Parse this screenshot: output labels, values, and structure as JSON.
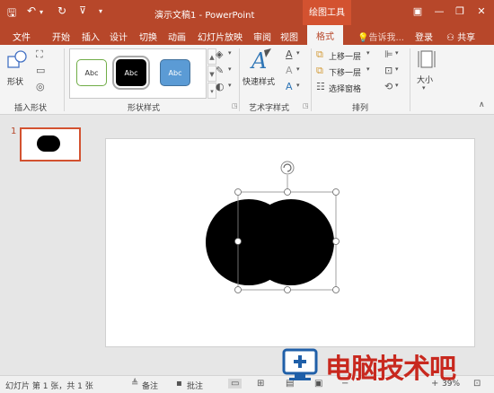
{
  "titlebar": {
    "title": "演示文稿1 - PowerPoint",
    "context_tab": "绘图工具",
    "icons": [
      "save-icon",
      "undo-icon",
      "redo-icon",
      "present-icon",
      "customize-icon"
    ],
    "window_buttons": [
      "▣",
      "—",
      "❐",
      "✕"
    ]
  },
  "tabs": {
    "items": [
      "文件",
      "开始",
      "插入",
      "设计",
      "切换",
      "动画",
      "幻灯片放映",
      "审阅",
      "视图"
    ],
    "active": "格式",
    "search": "告诉我...",
    "login": "登录",
    "share": "共享"
  },
  "ribbon": {
    "insert_shapes": {
      "label": "插入形状",
      "shapes_btn": "形状"
    },
    "shape_styles": {
      "label": "形状样式",
      "thumbs": [
        {
          "text": "Abc",
          "fill": "#ffffff",
          "border": "#70ad47",
          "color": "#333333"
        },
        {
          "text": "Abc",
          "fill": "#000000",
          "border": "#000000",
          "color": "#ffffff"
        },
        {
          "text": "Abc",
          "fill": "#5b9bd5",
          "border": "#41719c",
          "color": "#ffffff"
        }
      ]
    },
    "wordart": {
      "label": "艺术字样式",
      "quick_styles": "快速样式"
    },
    "arrange": {
      "label": "排列",
      "bring_forward": "上移一层",
      "send_backward": "下移一层",
      "selection_pane": "选择窗格"
    },
    "size": {
      "label": "大小"
    }
  },
  "thumbnail": {
    "slide_number": "1"
  },
  "statusbar": {
    "slide_info": "幻灯片 第 1 张，共 1 张",
    "notes": "备注",
    "comments": "批注",
    "zoom": "39%"
  },
  "watermark": {
    "text": "电脑技术吧"
  },
  "colors": {
    "accent": "#b7472a",
    "accent_light": "#d35230",
    "shape_fill": "#000000"
  }
}
